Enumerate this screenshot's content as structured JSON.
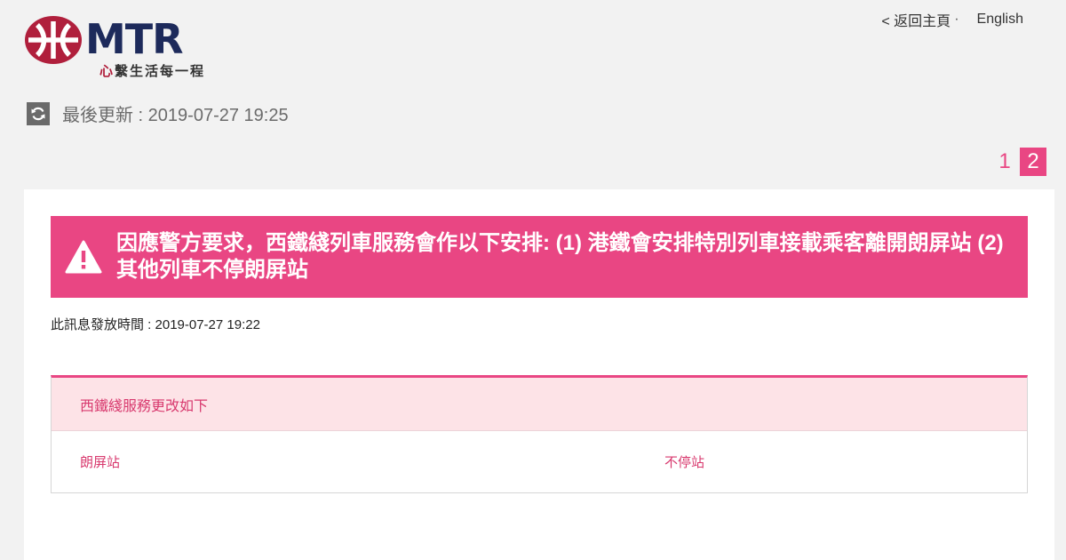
{
  "header": {
    "logo_text": "MTR",
    "tagline_accent": "心",
    "tagline_rest": "繫生活每一程",
    "back_home_label": "< 返回主頁",
    "separator": "·",
    "language_label": "English"
  },
  "update": {
    "label": "最後更新 : 2019-07-27 19:25"
  },
  "pagination": {
    "pages": [
      "1",
      "2"
    ],
    "active": "2"
  },
  "alert": {
    "message": "因應警方要求，西鐵綫列車服務會作以下安排: (1) 港鐵會安排特別列車接載乘客離開朗屏站 (2) 其他列車不停朗屏站",
    "issued_label": "此訊息發放時間 : 2019-07-27 19:22"
  },
  "service_table": {
    "heading": "西鐵綫服務更改如下",
    "rows": [
      {
        "station": "朗屏站",
        "status": "不停站"
      }
    ]
  },
  "colors": {
    "accent": "#e94683",
    "brand": "#b01f3c",
    "logo_text": "#1d2a5b"
  }
}
